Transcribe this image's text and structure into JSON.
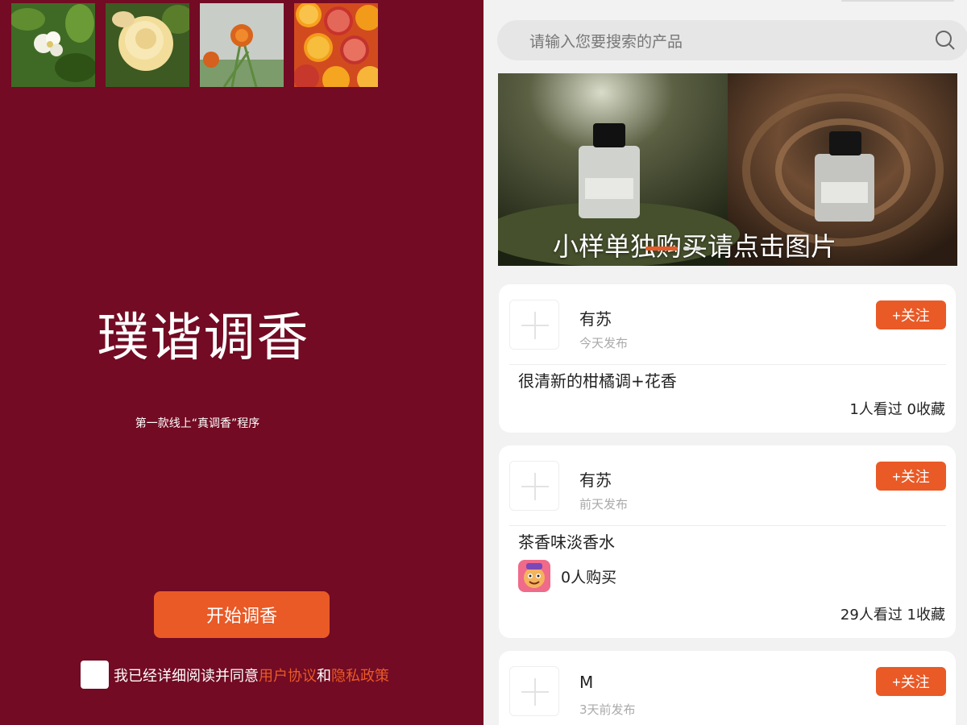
{
  "left": {
    "thumbnails": [
      {
        "icon": "white-flower-image"
      },
      {
        "icon": "yellow-rose-image"
      },
      {
        "icon": "marigold-image"
      },
      {
        "icon": "citrus-slices-image"
      }
    ],
    "brand": "璞谐调香",
    "tagline": "第一款线上“真调香”程序",
    "start_button": "开始调香",
    "agreement": {
      "prefix": "我已经详细阅读并同意",
      "user_agreement": "用户协议",
      "and": "和",
      "privacy_policy": "隐私政策"
    }
  },
  "right": {
    "search": {
      "placeholder": "请输入您要搜索的产品",
      "icon": "search-icon"
    },
    "banner": {
      "caption": "小样单独购买请点击图片"
    },
    "posts": [
      {
        "author": "有苏",
        "time": "今天发布",
        "follow": "+关注",
        "title": "很清新的柑橘调+花香",
        "stats": "1人看过  0收藏"
      },
      {
        "author": "有苏",
        "time": "前天发布",
        "follow": "+关注",
        "title": "茶香味淡香水",
        "buyers": "0人购买",
        "stats": "29人看过  1收藏"
      },
      {
        "author": "M",
        "time": "3天前发布",
        "follow": "+关注"
      }
    ]
  },
  "colors": {
    "left_bg": "#720b23",
    "accent": "#e95a26",
    "right_bg": "#f2f2f2"
  }
}
